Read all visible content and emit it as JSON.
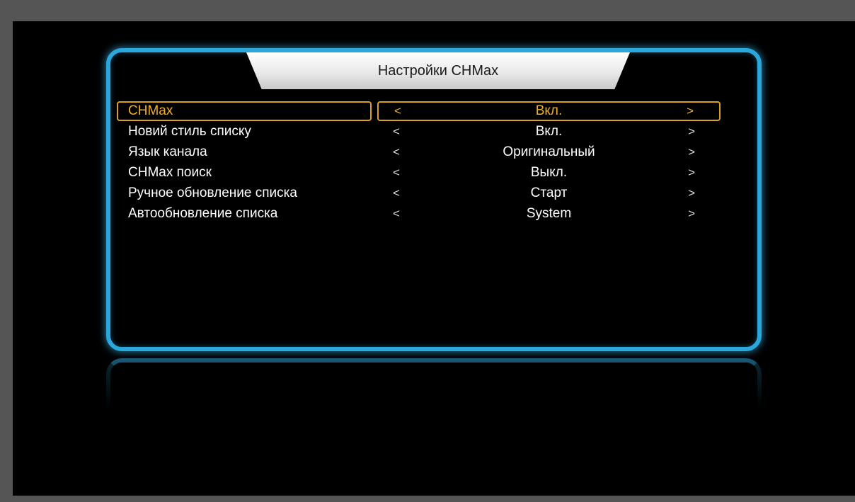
{
  "title": "Настройки CHMax",
  "settings": [
    {
      "label": "CHMax",
      "value": "Вкл.",
      "left_arrow": "<",
      "right_arrow": ">"
    },
    {
      "label": "Новий стиль списку",
      "value": "Вкл.",
      "left_arrow": "<",
      "right_arrow": ">"
    },
    {
      "label": "Язык канала",
      "value": "Оригинальный",
      "left_arrow": "<",
      "right_arrow": ">"
    },
    {
      "label": "CHMax поиск",
      "value": "Выкл.",
      "left_arrow": "<",
      "right_arrow": ">"
    },
    {
      "label": "Ручное обновление списка",
      "value": "Старт",
      "left_arrow": "<",
      "right_arrow": ">"
    },
    {
      "label": "Автообновление списка",
      "value": "System",
      "left_arrow": "<",
      "right_arrow": ">"
    }
  ],
  "colors": {
    "frame": "#2aa8dc",
    "highlight": "#f0b020",
    "background": "#000000"
  }
}
